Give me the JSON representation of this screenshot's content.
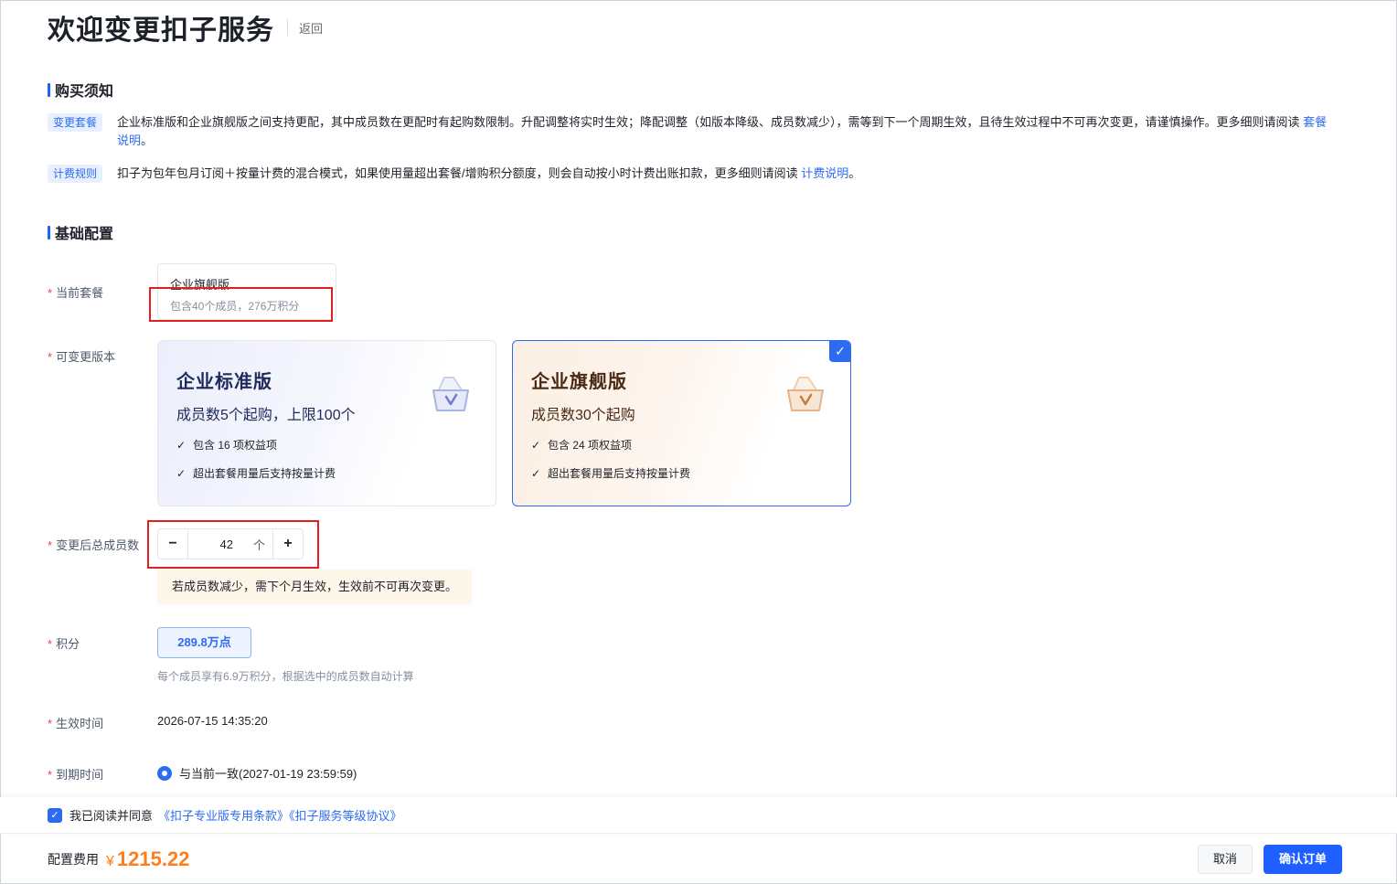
{
  "header": {
    "title": "欢迎变更扣子服务",
    "back_label": "返回"
  },
  "purchase_notice": {
    "title": "购买须知",
    "items": [
      {
        "tag": "变更套餐",
        "text": "企业标准版和企业旗舰版之间支持更配，其中成员数在更配时有起购数限制。升配调整将实时生效；降配调整（如版本降级、成员数减少），需等到下一个周期生效，且待生效过程中不可再次变更，请谨慎操作。更多细则请阅读 ",
        "link": "套餐说明",
        "suffix": "。"
      },
      {
        "tag": "计费规则",
        "text": "扣子为包年包月订阅＋按量计费的混合模式，如果使用量超出套餐/增购积分额度，则会自动按小时计费出账扣款，更多细则请阅读 ",
        "link": "计费说明",
        "suffix": "。"
      }
    ]
  },
  "basic_config": {
    "title": "基础配置",
    "current_plan": {
      "label": "当前套餐",
      "name": "企业旗舰版",
      "desc": "包含40个成员，276万积分"
    },
    "plan_options": {
      "label": "可变更版本",
      "cards": [
        {
          "name": "企业标准版",
          "sub": "成员数5个起购，上限100个",
          "features": [
            "包含 16 项权益项",
            "超出套餐用量后支持按量计费"
          ]
        },
        {
          "name": "企业旗舰版",
          "sub": "成员数30个起购",
          "features": [
            "包含 24 项权益项",
            "超出套餐用量后支持按量计费"
          ]
        }
      ],
      "selected_mark": "✓"
    },
    "members": {
      "label": "变更后总成员数",
      "value": "42",
      "unit": "个",
      "minus": "−",
      "plus": "+",
      "warning": "若成员数减少，需下个月生效，生效前不可再次变更。"
    },
    "points": {
      "label": "积分",
      "value": "289.8万点",
      "hint": "每个成员享有6.9万积分，根据选中的成员数自动计算"
    },
    "effective_time": {
      "label": "生效时间",
      "value": "2026-07-15 14:35:20"
    },
    "expire_time": {
      "label": "到期时间",
      "option": "与当前一致(2027-01-19 23:59:59)"
    }
  },
  "agreement": {
    "checked_mark": "✓",
    "text": "我已阅读并同意",
    "links": "《扣子专业版专用条款》《扣子服务等级协议》"
  },
  "footer": {
    "fee_label": "配置费用",
    "currency": "¥",
    "fee": "1215.22",
    "cancel": "取消",
    "confirm": "确认订单"
  },
  "colors": {
    "accent": "#1f5fff",
    "price": "#ff7d1a",
    "required": "#f53f3f",
    "highlight_box": "#e02020"
  }
}
